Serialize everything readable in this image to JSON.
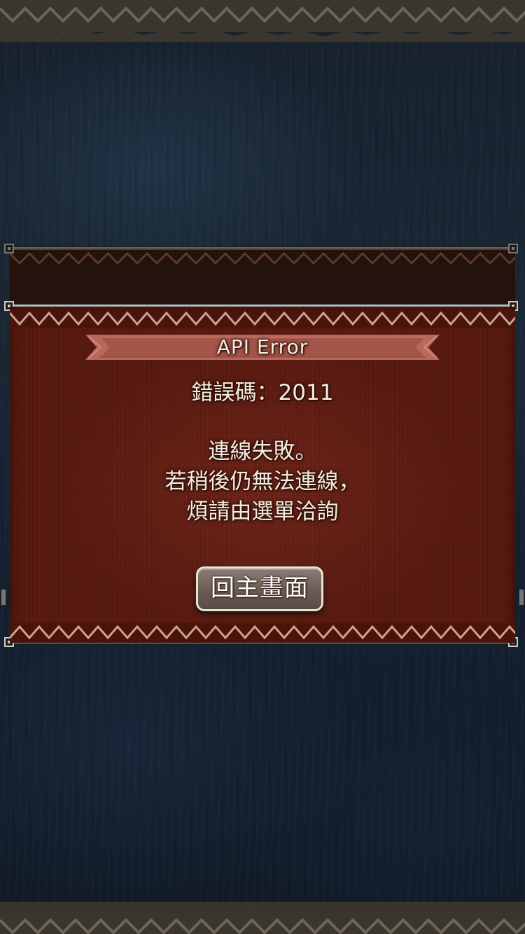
{
  "dialog": {
    "title": "API Error",
    "error_code_label": "錯誤碼",
    "error_code_separator": "：",
    "error_code_value": "2011",
    "message_lines": [
      "連線失敗。",
      "若稍後仍無法連線，",
      "煩請由選單洽詢"
    ],
    "button_label": "回主畫面"
  },
  "colors": {
    "background": "#17222e",
    "panel": "#5e1c12",
    "zigzag": "#c9a58f",
    "ribbon": "#b8675a",
    "rail": "#d8d0c4",
    "button": "#6b5d54",
    "text": "#f4ece0"
  }
}
